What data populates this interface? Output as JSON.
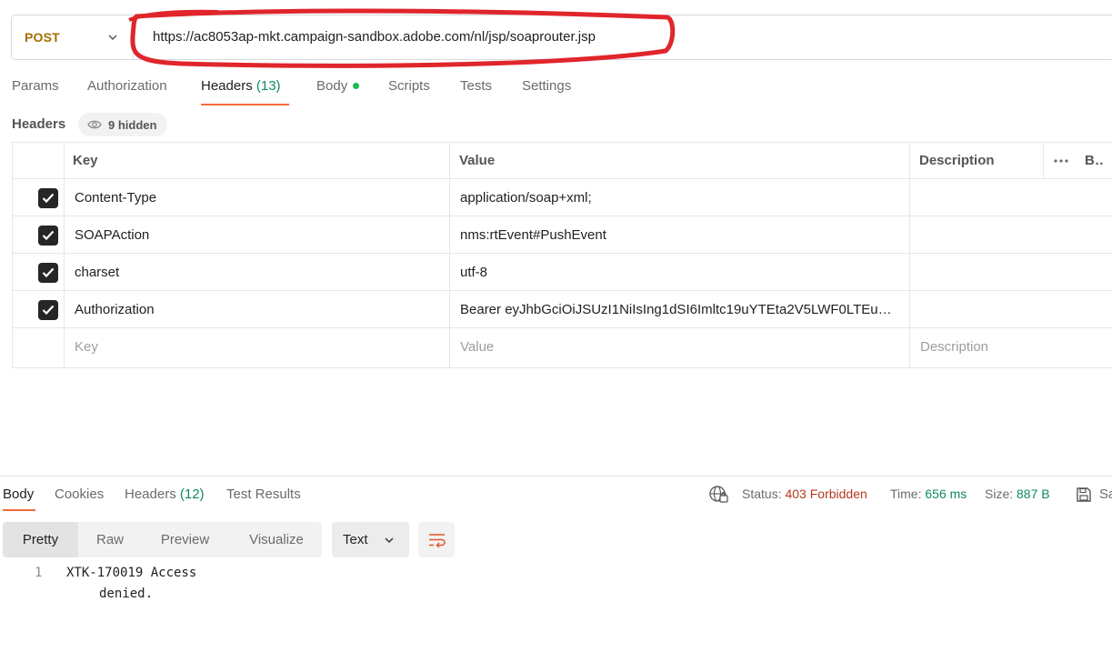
{
  "request": {
    "method": "POST",
    "url": "https://ac8053ap-mkt.campaign-sandbox.adobe.com/nl/jsp/soaprouter.jsp"
  },
  "request_tabs": [
    {
      "label": "Params"
    },
    {
      "label": "Authorization"
    },
    {
      "label": "Headers",
      "count": "(13)"
    },
    {
      "label": "Body"
    },
    {
      "label": "Scripts"
    },
    {
      "label": "Tests"
    },
    {
      "label": "Settings"
    }
  ],
  "headers_section": {
    "title": "Headers",
    "hidden_label": "9 hidden",
    "columns": {
      "key": "Key",
      "value": "Value",
      "description": "Description",
      "bulk": "Bulk Edit"
    },
    "rows": [
      {
        "key": "Content-Type",
        "value": "application/soap+xml;",
        "checked": true
      },
      {
        "key": "SOAPAction",
        "value": "nms:rtEvent#PushEvent",
        "checked": true
      },
      {
        "key": "charset",
        "value": "utf-8",
        "checked": true
      },
      {
        "key": "Authorization",
        "value": "Bearer eyJhbGciOiJSUzI1NiIsIng1dSI6Imltc19uYTEta2V5LWF0LTEu…",
        "checked": true
      }
    ],
    "placeholders": {
      "key": "Key",
      "value": "Value",
      "description": "Description"
    }
  },
  "response": {
    "tabs": [
      {
        "label": "Body"
      },
      {
        "label": "Cookies"
      },
      {
        "label": "Headers",
        "count": "(12)"
      },
      {
        "label": "Test Results"
      }
    ],
    "status_label": "Status:",
    "status_value": "403 Forbidden",
    "time_label": "Time:",
    "time_value": "656 ms",
    "size_label": "Size:",
    "size_value": "887 B",
    "save_label": "Save Response",
    "formats": [
      "Pretty",
      "Raw",
      "Preview",
      "Visualize"
    ],
    "language": "Text",
    "body_lines": [
      {
        "number": "1",
        "text": "XTK-170019 Access",
        "continuation": "denied."
      }
    ]
  },
  "colors": {
    "accent": "#f26b3a",
    "method": "#a56e00",
    "status_error": "#b33a1f",
    "status_ok": "#0f8a5f",
    "annotation": "#e0262b"
  }
}
